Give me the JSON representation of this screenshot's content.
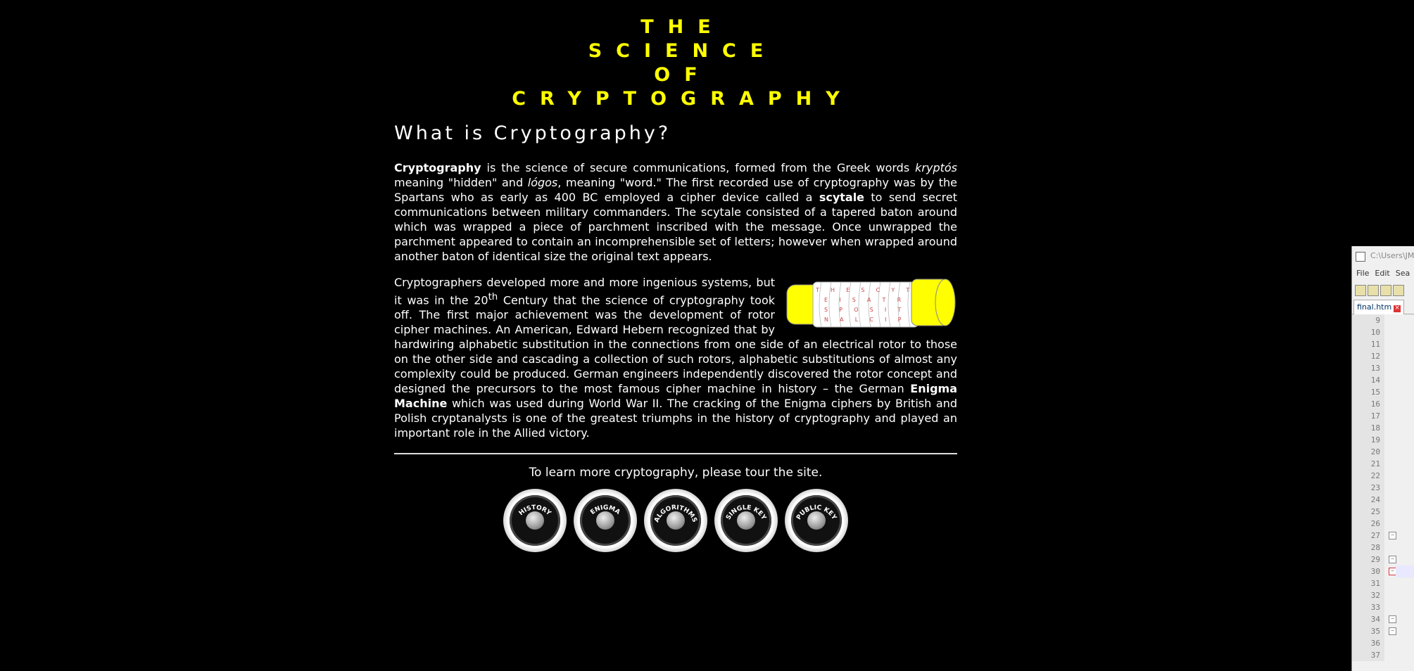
{
  "title": {
    "lines": [
      "THE",
      "SCIENCE",
      "OF",
      "CRYPTOGRAPHY"
    ]
  },
  "heading": "What is Cryptography?",
  "para1": {
    "b1": "Cryptography",
    "t1": " is the science of secure communications, formed from the Greek words ",
    "i1": "kryptós",
    "t2": " meaning \"hidden\" and ",
    "i2": "lógos",
    "t3": ", meaning \"word.\" The first recorded use of cryptography was by the Spartans who as early as 400 BC employed a cipher device called a ",
    "b2": "scytale",
    "t4": " to send secret communications between military commanders. The scytale consisted of a tapered baton around which was wrapped a piece of parchment inscribed with the message. Once unwrapped the parchment appeared to contain an incomprehensible set of letters; however when wrapped around another baton of identical size the original text appears."
  },
  "para2": {
    "t1": "Cryptographers developed more and more ingenious systems, but it was in the 20",
    "sup": "th",
    "t2": " Century that the science of cryptography took off. The first major achievement was the development of rotor cipher machines. An American, Edward Hebern recognized that by hardwiring alphabetic substitution in the connections from one side of an electrical rotor to those on the other side and cascading a collection of such rotors, alphabetic substitutions of almost any complexity could be produced. German engineers independently discovered the rotor concept and designed the precursors to the most famous cipher machine in history – the German ",
    "b1": "Enigma Machine",
    "t3": " which was used during World War II. The cracking of the Enigma ciphers by British and Polish cryptanalysts is one of the greatest triumphs in the history of cryptography and played an important role in the Allied victory."
  },
  "scytale_rows": [
    "T H E S C Y T A L",
    "E I S A T R A N",
    "S P O S I T I O",
    "N A L C I P H E R"
  ],
  "tour_text": "To learn more cryptography, please tour the site.",
  "nav": [
    "HISTORY",
    "ENIGMA",
    "ALGORITHMS",
    "SINGLE KEY",
    "PUBLIC KEY"
  ],
  "colors": {
    "title": "#ffff00",
    "background": "#000000",
    "text": "#ffffff"
  },
  "editor": {
    "title": "C:\\Users\\JM",
    "menu": [
      "File",
      "Edit",
      "Sea"
    ],
    "tab": "final.htm",
    "line_numbers": [
      "9",
      "10",
      "11",
      "12",
      "13",
      "14",
      "15",
      "16",
      "17",
      "18",
      "19",
      "20",
      "21",
      "22",
      "23",
      "24",
      "25",
      "26",
      "27",
      "28",
      "29",
      "30",
      "31",
      "32",
      "33",
      "34",
      "35",
      "36",
      "37"
    ]
  }
}
